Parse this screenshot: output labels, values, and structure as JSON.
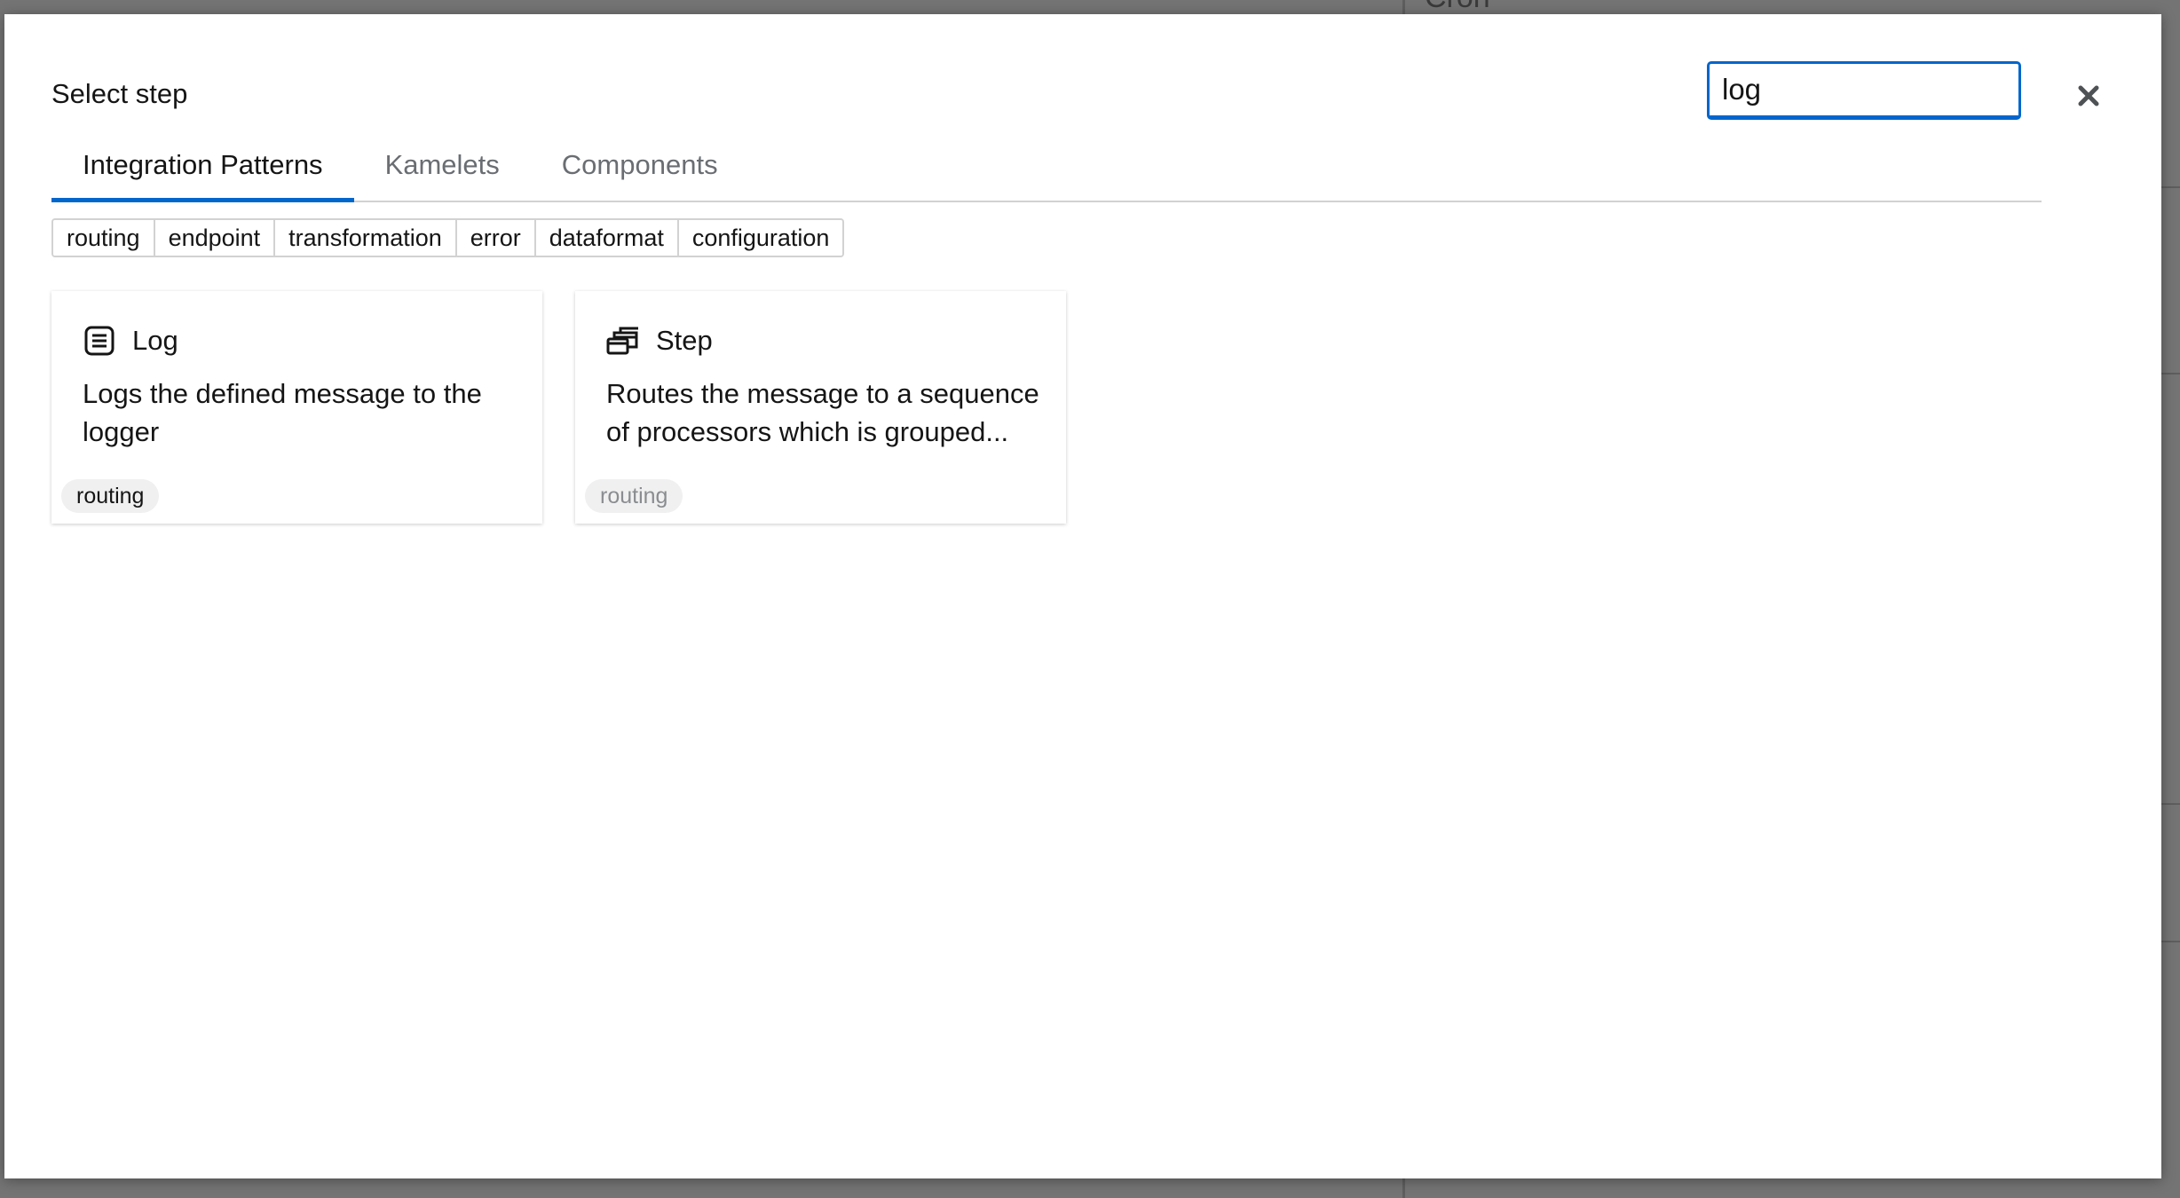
{
  "background": {
    "partial_text": "Cron"
  },
  "modal": {
    "title": "Select step",
    "search": {
      "value": "log"
    },
    "close_icon": "close-icon",
    "tabs": [
      {
        "label": "Integration Patterns",
        "active": true
      },
      {
        "label": "Kamelets",
        "active": false
      },
      {
        "label": "Components",
        "active": false
      }
    ],
    "filters": [
      "routing",
      "endpoint",
      "transformation",
      "error",
      "dataformat",
      "configuration"
    ],
    "cards": [
      {
        "icon": "list-icon",
        "title": "Log",
        "description": "Logs the defined message to the logger",
        "tag": "routing"
      },
      {
        "icon": "step-windows-icon",
        "title": "Step",
        "description": "Routes the message to a sequence of processors which is grouped...",
        "tag": "routing"
      }
    ]
  },
  "colors": {
    "accent": "#0066cc",
    "text": "#151515",
    "muted": "#6a6e73"
  }
}
